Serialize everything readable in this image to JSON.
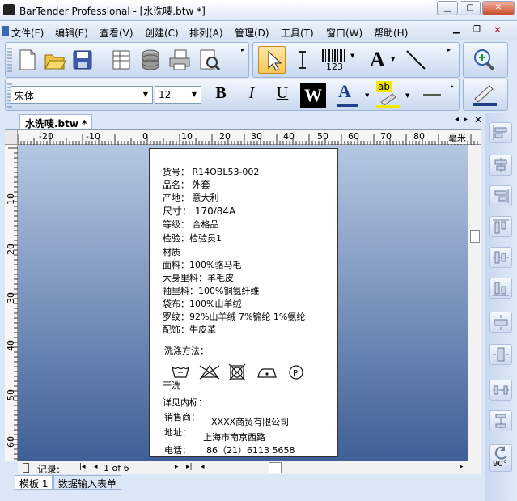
{
  "window": {
    "title": "BarTender Professional - [水洗唛.btw *]"
  },
  "menu": [
    "文件(F)",
    "编辑(E)",
    "查看(V)",
    "创建(C)",
    "排列(A)",
    "管理(D)",
    "工具(T)",
    "窗口(W)",
    "帮助(H)"
  ],
  "format_toolbar": {
    "font": "宋体",
    "size": "12",
    "bold": "B",
    "italic": "I",
    "underline": "U",
    "wordart": "W",
    "font_color": "A",
    "highlight": "ab"
  },
  "toolbar": {
    "barcode_label": "123",
    "text_label": "A"
  },
  "doc_tab": "水洗唛.btw *",
  "ruler": {
    "top_ticks": [
      "-20",
      "-10",
      "0",
      "10",
      "20",
      "30",
      "40",
      "50",
      "60",
      "70",
      "80",
      "90"
    ],
    "unit": "毫米",
    "left_ticks": [
      "10",
      "20",
      "30",
      "40",
      "50",
      "60"
    ]
  },
  "label": {
    "lines": [
      "货号：   R14OBL53-002",
      "品名：   外套",
      "产地：   意大利",
      "尺寸：   170/84A",
      "等级：  合格品",
      "检验：检验员1",
      "材质",
      "面料：100%骆马毛",
      "大身里料：羊毛皮",
      "袖里料：100%铜氨纤维",
      "袋布：100%山羊绒",
      "罗纹：92%山羊绒 7%锦纶 1%氨纶",
      "配饰：牛皮革"
    ],
    "wash_title": "洗涤方法：",
    "dry_clean": "干洗",
    "see_tag": "详见内标：",
    "seller_label": "销售商：",
    "seller_value": "XXXX商贸有限公司",
    "address_label": "地址：",
    "address_value": "上海市南京西路",
    "phone_label": "电话：",
    "phone_value": "86（21）6113 5658"
  },
  "status": {
    "records_label": "记录:",
    "record_pos": "1 of 6"
  },
  "bottom_tabs": [
    "模板 1",
    "数据输入表单"
  ],
  "rotate": "90°"
}
